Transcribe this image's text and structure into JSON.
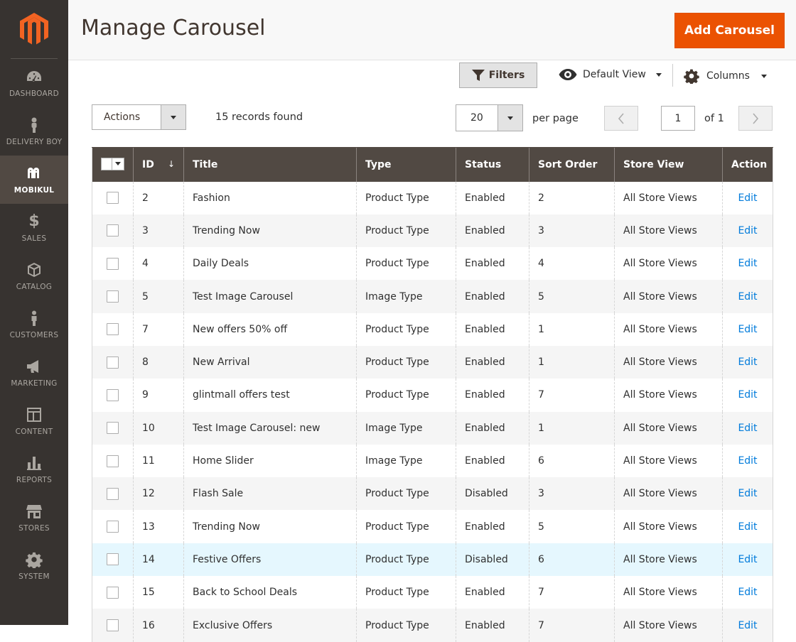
{
  "sidebar": {
    "logo": "magento-logo",
    "items": [
      {
        "label": "DASHBOARD",
        "icon": "dashboard-icon",
        "active": false
      },
      {
        "label": "DELIVERY BOY",
        "icon": "delivery-boy-icon",
        "active": false
      },
      {
        "label": "MOBIKUL",
        "icon": "mobikul-icon",
        "active": true
      },
      {
        "label": "SALES",
        "icon": "dollar-icon",
        "active": false
      },
      {
        "label": "CATALOG",
        "icon": "box-icon",
        "active": false
      },
      {
        "label": "CUSTOMERS",
        "icon": "person-icon",
        "active": false
      },
      {
        "label": "MARKETING",
        "icon": "megaphone-icon",
        "active": false
      },
      {
        "label": "CONTENT",
        "icon": "layout-icon",
        "active": false
      },
      {
        "label": "REPORTS",
        "icon": "bar-chart-icon",
        "active": false
      },
      {
        "label": "STORES",
        "icon": "store-icon",
        "active": false
      },
      {
        "label": "SYSTEM",
        "icon": "gear-icon",
        "active": false
      }
    ],
    "dollar_glyph": "$"
  },
  "header": {
    "title": "Manage Carousel",
    "add_button": "Add Carousel"
  },
  "toolbar": {
    "filters": "Filters",
    "view": "Default View",
    "columns": "Columns",
    "actions": "Actions",
    "records": "15 records found",
    "per_page_value": "20",
    "per_page_label": "per page",
    "page_value": "1",
    "page_of": "of 1"
  },
  "grid": {
    "headers": {
      "id": "ID",
      "title": "Title",
      "type": "Type",
      "status": "Status",
      "sort_order": "Sort Order",
      "store_view": "Store View",
      "action": "Action"
    },
    "sort_indicator": "↓",
    "rows": [
      {
        "id": "2",
        "title": "Fashion",
        "type": "Product Type",
        "status": "Enabled",
        "sort": "2",
        "store": "All Store Views",
        "action": "Edit"
      },
      {
        "id": "3",
        "title": "Trending Now",
        "type": "Product Type",
        "status": "Enabled",
        "sort": "3",
        "store": "All Store Views",
        "action": "Edit"
      },
      {
        "id": "4",
        "title": "Daily Deals",
        "type": "Product Type",
        "status": "Enabled",
        "sort": "4",
        "store": "All Store Views",
        "action": "Edit"
      },
      {
        "id": "5",
        "title": "Test Image Carousel",
        "type": "Image Type",
        "status": "Enabled",
        "sort": "5",
        "store": "All Store Views",
        "action": "Edit"
      },
      {
        "id": "7",
        "title": "New offers 50% off",
        "type": "Product Type",
        "status": "Enabled",
        "sort": "1",
        "store": "All Store Views",
        "action": "Edit"
      },
      {
        "id": "8",
        "title": "New Arrival",
        "type": "Product Type",
        "status": "Enabled",
        "sort": "1",
        "store": "All Store Views",
        "action": "Edit"
      },
      {
        "id": "9",
        "title": "glintmall offers test",
        "type": "Product Type",
        "status": "Enabled",
        "sort": "7",
        "store": "All Store Views",
        "action": "Edit"
      },
      {
        "id": "10",
        "title": "Test Image Carousel: new",
        "type": "Image Type",
        "status": "Enabled",
        "sort": "1",
        "store": "All Store Views",
        "action": "Edit"
      },
      {
        "id": "11",
        "title": "Home Slider",
        "type": "Image Type",
        "status": "Enabled",
        "sort": "6",
        "store": "All Store Views",
        "action": "Edit"
      },
      {
        "id": "12",
        "title": "Flash Sale",
        "type": "Product Type",
        "status": "Disabled",
        "sort": "3",
        "store": "All Store Views",
        "action": "Edit"
      },
      {
        "id": "13",
        "title": "Trending Now",
        "type": "Product Type",
        "status": "Enabled",
        "sort": "5",
        "store": "All Store Views",
        "action": "Edit"
      },
      {
        "id": "14",
        "title": "Festive Offers",
        "type": "Product Type",
        "status": "Disabled",
        "sort": "6",
        "store": "All Store Views",
        "action": "Edit"
      },
      {
        "id": "15",
        "title": "Back to School Deals",
        "type": "Product Type",
        "status": "Enabled",
        "sort": "7",
        "store": "All Store Views",
        "action": "Edit"
      },
      {
        "id": "16",
        "title": "Exclusive Offers",
        "type": "Product Type",
        "status": "Enabled",
        "sort": "7",
        "store": "All Store Views",
        "action": "Edit"
      }
    ],
    "highlighted_row_id": "14"
  },
  "colors": {
    "sidebar_bg": "#373330",
    "accent": "#eb5202",
    "table_header_bg": "#514943",
    "link": "#007bdb",
    "highlight_row": "#e5f7fe"
  }
}
